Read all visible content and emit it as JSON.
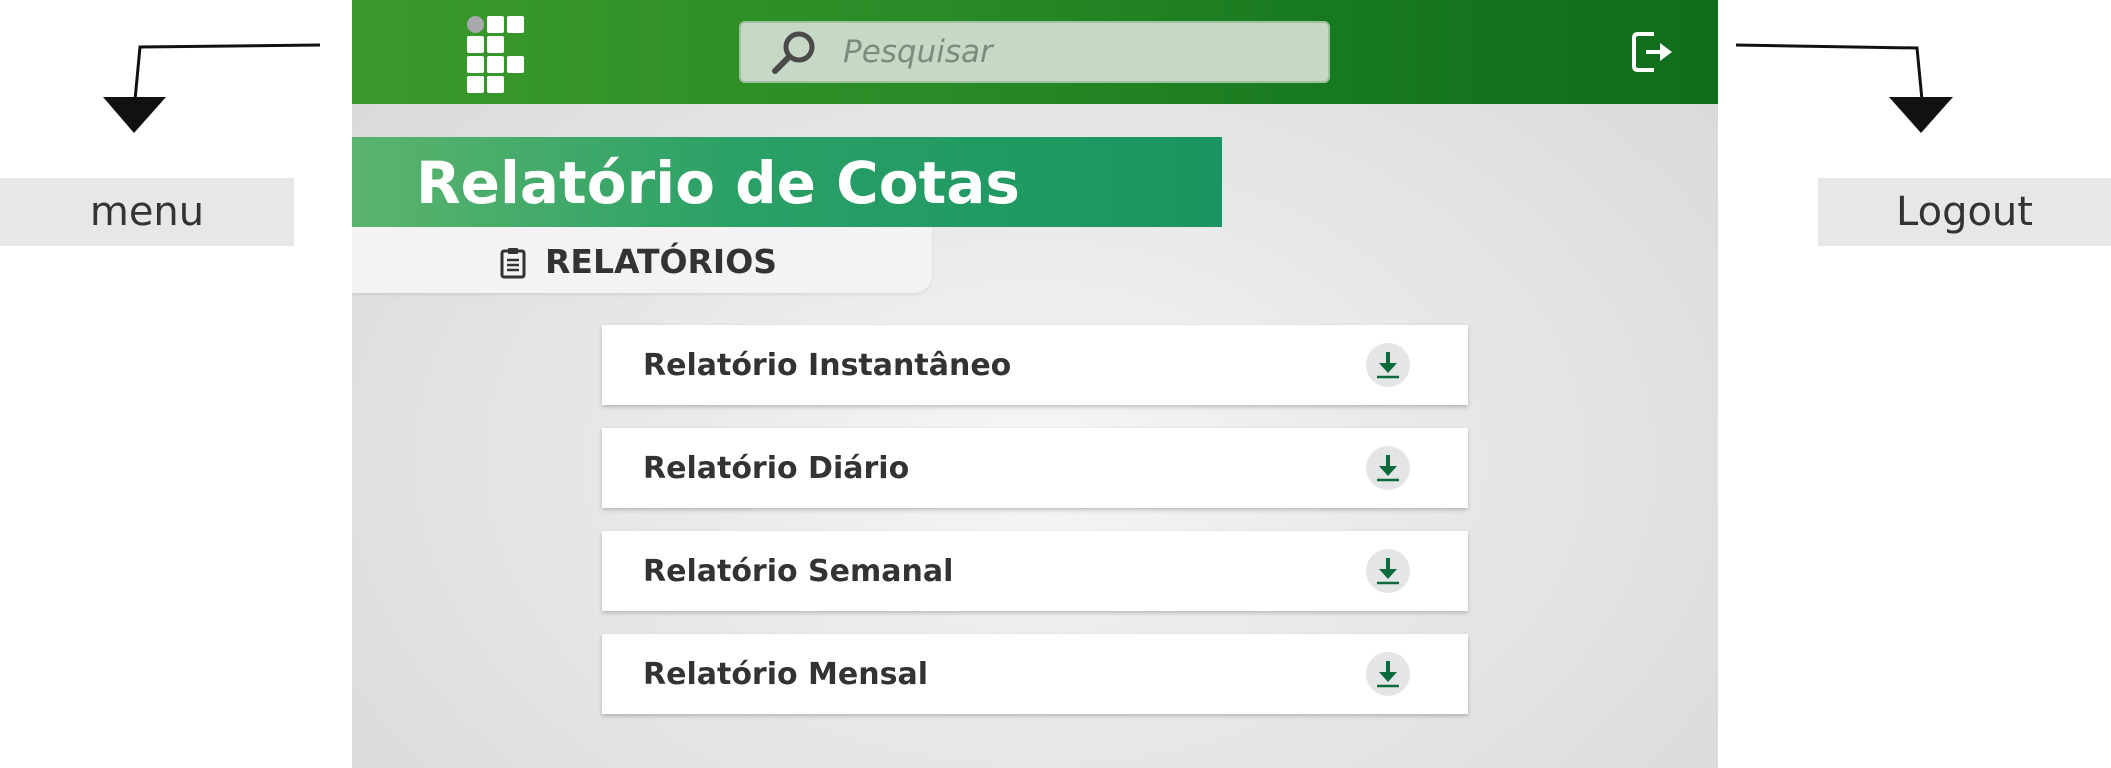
{
  "annotations": {
    "menu_label": "menu",
    "logout_label": "Logout"
  },
  "header": {
    "logo_icon": "institution-logo-icon",
    "search": {
      "placeholder": "Pesquisar",
      "value": "",
      "icon": "search-icon"
    },
    "logout_icon": "logout-icon",
    "brand_color": "#2b8c27"
  },
  "page": {
    "title": "Relatório de Cotas",
    "section_label": "RELATÓRIOS",
    "section_icon": "clipboard-icon"
  },
  "reports": [
    {
      "label": "Relatório Instantâneo",
      "icon": "download-icon"
    },
    {
      "label": "Relatório Diário",
      "icon": "download-icon"
    },
    {
      "label": "Relatório Semanal",
      "icon": "download-icon"
    },
    {
      "label": "Relatório Mensal",
      "icon": "download-icon"
    }
  ],
  "colors": {
    "accent_green": "#1e8c5a",
    "icon_green": "#0c6b3a"
  }
}
